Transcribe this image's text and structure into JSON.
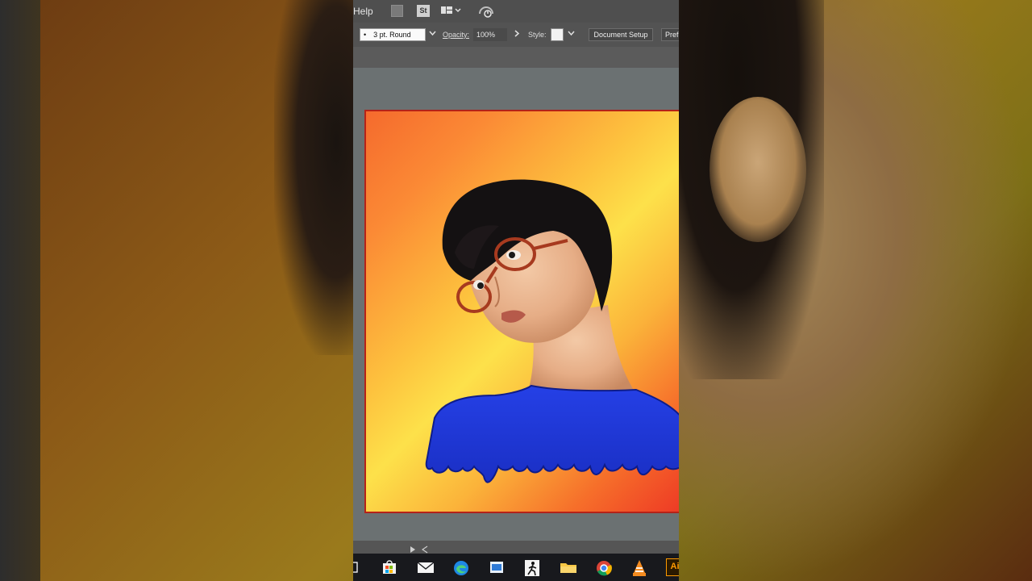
{
  "menu": {
    "help_label": "Help"
  },
  "control_bar": {
    "stroke_value": "3 pt. Round",
    "opacity_label": "Opacity:",
    "opacity_value": "100%",
    "style_label": "Style:",
    "document_setup_label": "Document Setup",
    "preferences_label": "Pref"
  },
  "taskbar": {
    "apps": [
      "task-view-icon",
      "store-icon",
      "mail-icon",
      "edge-icon",
      "explorer-window-icon",
      "media-app-icon",
      "file-explorer-icon",
      "chrome-icon",
      "vlc-icon",
      "illustrator-icon"
    ],
    "illustrator_label": "Ai"
  },
  "colors": {
    "accent_red": "#b52218",
    "shirt_blue": "#1e3bd8",
    "taskbar": "#18191d"
  }
}
